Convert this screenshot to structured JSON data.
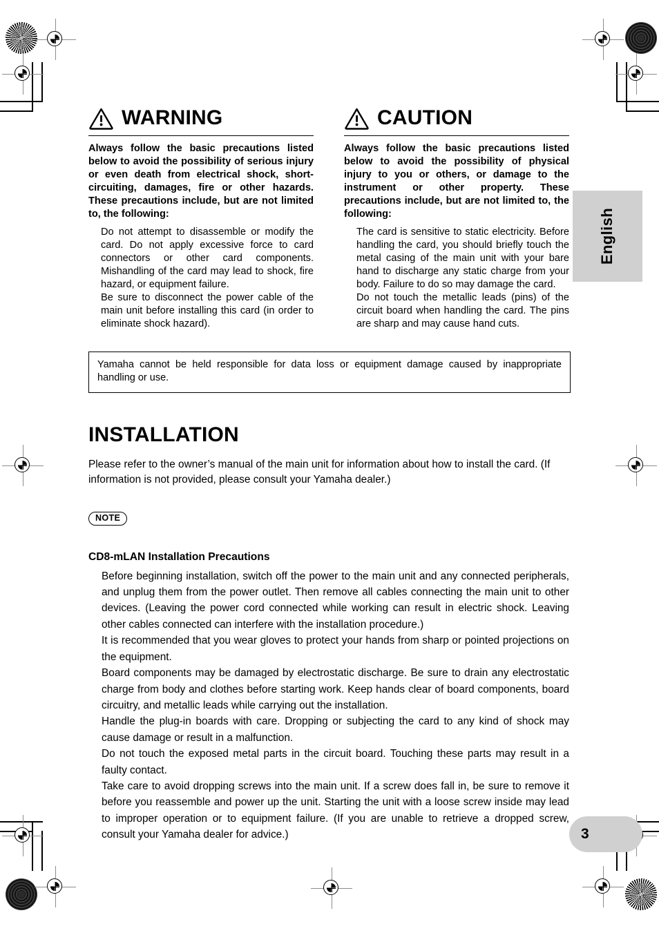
{
  "document": {
    "page_number": "3",
    "language_tab": "English"
  },
  "alerts": [
    {
      "icon": "warning-triangle-icon",
      "title": "WARNING",
      "lead": "Always follow the basic precautions listed below to avoid the possibility of serious injury or even death from electrical shock, short-circuiting, damages, fire or other hazards. These precautions include, but are not limited to, the following:",
      "items": [
        "Do not attempt to disassemble or modify the card. Do not apply excessive force to card connectors or other card components. Mishandling of the card may lead to shock, fire hazard, or equipment failure.",
        "Be sure to disconnect the power cable of the main unit before installing this card (in order to eliminate shock hazard)."
      ]
    },
    {
      "icon": "caution-triangle-icon",
      "title": "CAUTION",
      "lead": "Always follow the basic precautions listed below to avoid the possibility of physical injury to you or others, or damage to the instrument or other property. These precautions include, but are not limited to, the following:",
      "items": [
        "The card is sensitive to static electricity. Before handling the card, you should briefly touch the metal casing of the main unit with your bare hand to discharge any static charge from your body. Failure to do so may damage the card.",
        "Do not touch the metallic leads (pins) of the circuit board when handling the card. The pins are sharp and may cause hand cuts."
      ]
    }
  ],
  "disclaimer": "Yamaha cannot be held responsible for data loss or equipment damage caused by inappropriate handling or use.",
  "installation": {
    "title": "INSTALLATION",
    "intro": "Please refer to the owner’s manual of the main unit for information about how to install the card. (If information is not provided, please consult your Yamaha dealer.)",
    "note_label": "NOTE",
    "precautions_title": "CD8-mLAN Installation Precautions",
    "precautions": [
      "Before beginning installation, switch off the power to the main unit and any connected peripherals, and unplug them from the power outlet. Then remove all cables connecting the main unit to other devices. (Leaving the power cord connected while working can result in electric shock. Leaving other cables connected can interfere with the installation procedure.)",
      "It is recommended that you wear gloves to protect your hands from sharp or pointed projections on the equipment.",
      "Board components may be damaged by electrostatic discharge. Be sure to drain any electrostatic charge from body and clothes before starting work. Keep hands clear of board components, board circuitry, and metallic leads while carrying out the installation.",
      "Handle the plug-in boards with care. Dropping or subjecting the card to any kind of shock may cause damage or result in a malfunction.",
      "Do not touch the exposed metal parts in the circuit board. Touching these parts may result in a faulty contact.",
      "Take care to avoid dropping screws into the main unit. If a screw does fall in, be sure to remove it before you reassemble and power up the unit. Starting the unit with a loose screw inside may lead to improper operation or to equipment failure. (If you are unable to retrieve a dropped screw, consult your Yamaha dealer for advice.)"
    ]
  },
  "colors": {
    "tab_gray": "#d0d0d0",
    "ink": "#000000",
    "regmark_gray": "#8c8c8c"
  }
}
